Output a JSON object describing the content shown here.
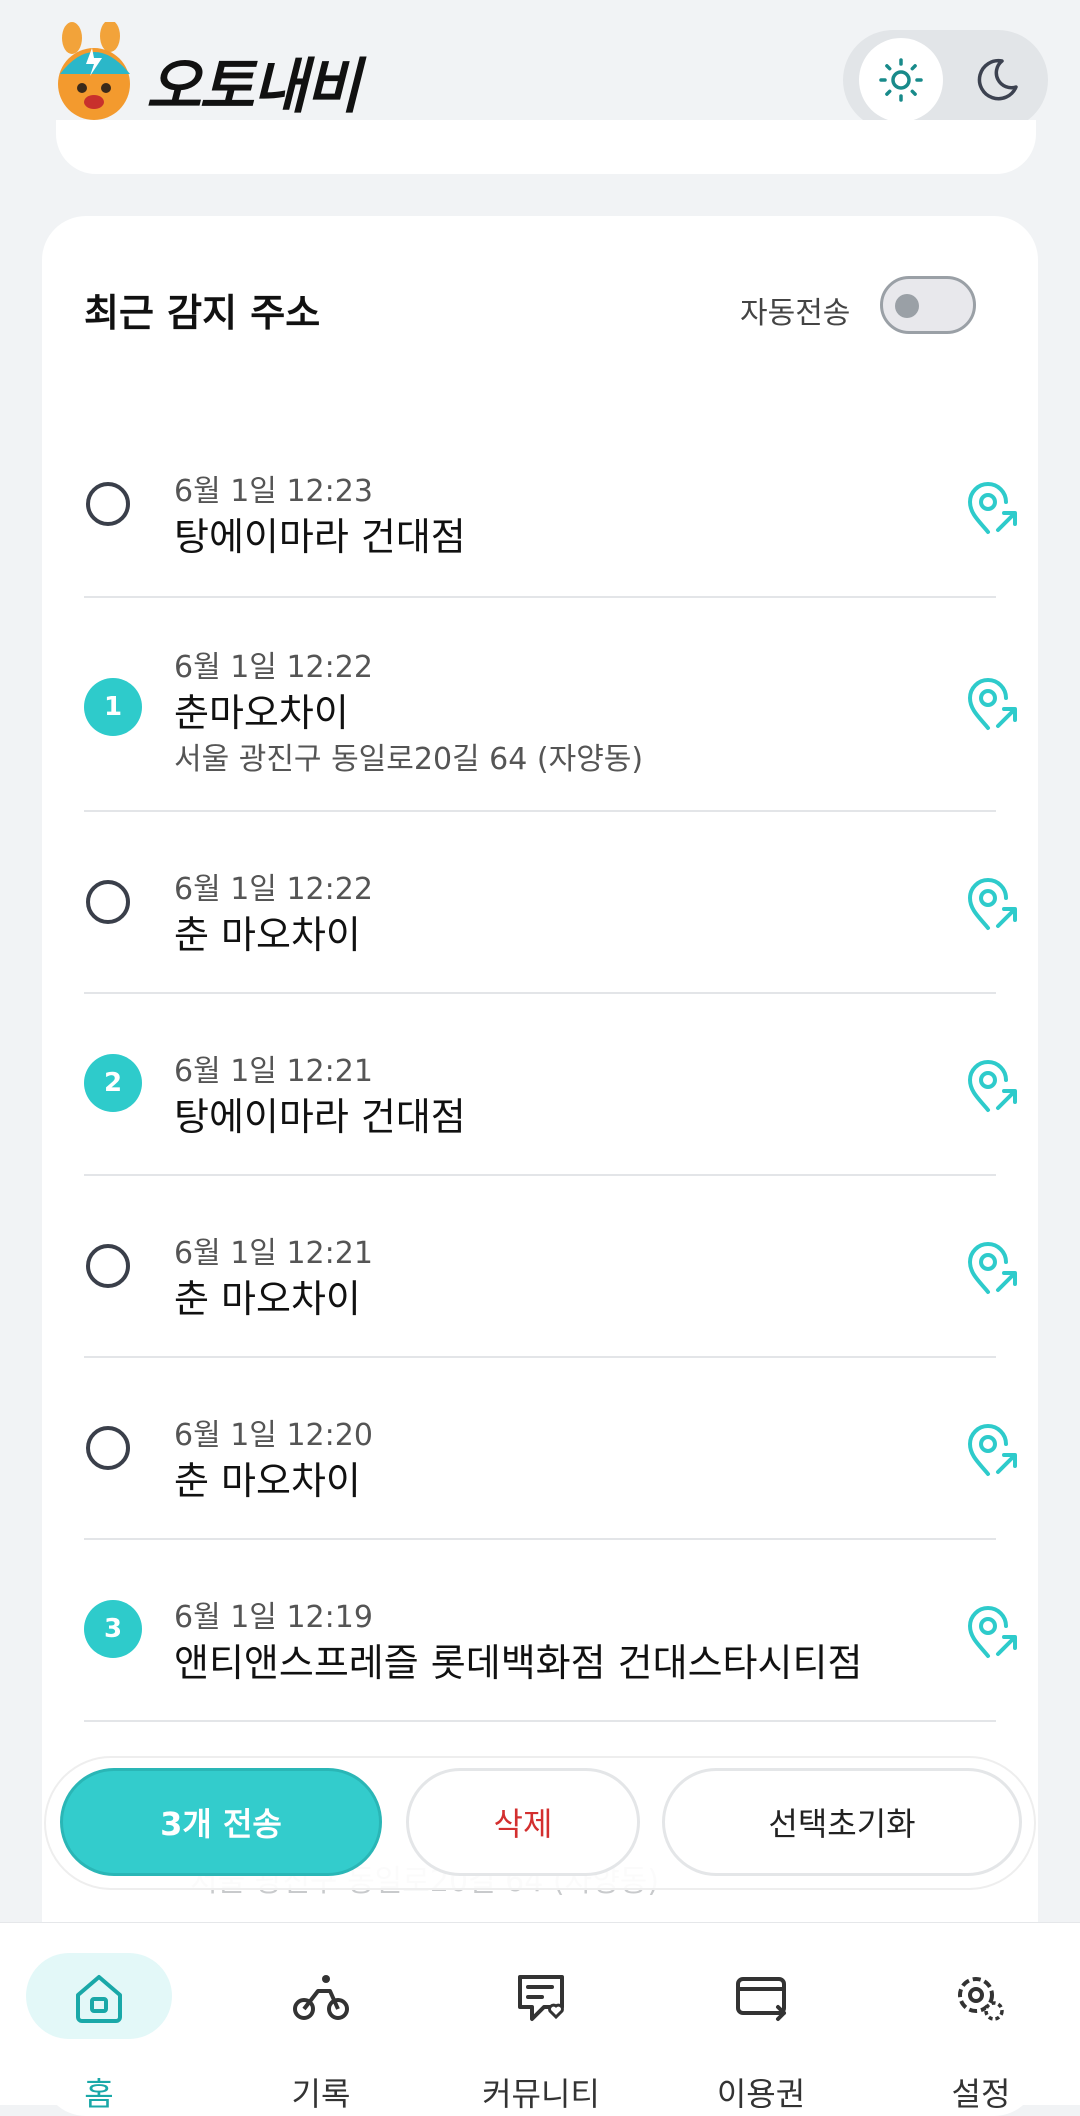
{
  "app": {
    "name": "오토내비"
  },
  "theme": {
    "light_icon": "sun-icon",
    "dark_icon": "moon-icon",
    "accent": "#33cccc"
  },
  "section": {
    "title": "최근 감지 주소",
    "auto_send_label": "자동전송",
    "auto_send_on": false
  },
  "items": [
    {
      "time": "6월 1일 12:23",
      "name": "탕에이마라 건대점",
      "address": "",
      "order": ""
    },
    {
      "time": "6월 1일 12:22",
      "name": "춘마오차이",
      "address": "서울 광진구 동일로20길 64 (자양동)",
      "order": "1"
    },
    {
      "time": "6월 1일 12:22",
      "name": "춘 마오차이",
      "address": "",
      "order": ""
    },
    {
      "time": "6월 1일 12:21",
      "name": "탕에이마라 건대점",
      "address": "",
      "order": "2"
    },
    {
      "time": "6월 1일 12:21",
      "name": "춘 마오차이",
      "address": "",
      "order": ""
    },
    {
      "time": "6월 1일 12:20",
      "name": "춘 마오차이",
      "address": "",
      "order": ""
    },
    {
      "time": "6월 1일 12:19",
      "name": "앤티앤스프레즐 롯데백화점 건대스타시티점",
      "address": "",
      "order": "3"
    }
  ],
  "hidden_row_text": "서울 광진구 동일로20길 64 (자양동)",
  "actions": {
    "send": "3개 전송",
    "delete": "삭제",
    "reset": "선택초기화"
  },
  "tabs": [
    {
      "label": "홈",
      "icon": "home-icon",
      "active": true
    },
    {
      "label": "기록",
      "icon": "bike-icon",
      "active": false
    },
    {
      "label": "커뮤니티",
      "icon": "community-icon",
      "active": false
    },
    {
      "label": "이용권",
      "icon": "ticket-icon",
      "active": false
    },
    {
      "label": "설정",
      "icon": "settings-icon",
      "active": false
    }
  ]
}
